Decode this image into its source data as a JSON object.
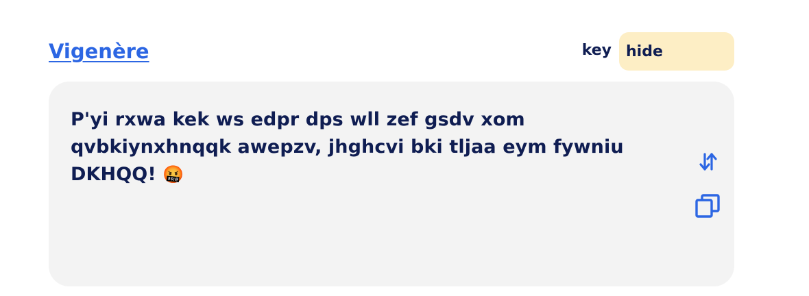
{
  "header": {
    "title": "Vigenère",
    "key_label": "key",
    "key_value": "hide"
  },
  "panel": {
    "text": "P'yi rxwa kek ws edpr dps wll zef gsdv xom qvbkiynxhnqqk awepzv, jhghcvi bki tljaa eym fywniu DKHQQ!",
    "emoji": "🤬"
  },
  "icons": {
    "swap": "swap-vertical-arrows-icon",
    "copy": "copy-icon"
  },
  "colors": {
    "accent": "#2c66e3",
    "text": "#0f1d52",
    "panel_bg": "#f3f3f3",
    "key_bg": "#fdeec5"
  }
}
